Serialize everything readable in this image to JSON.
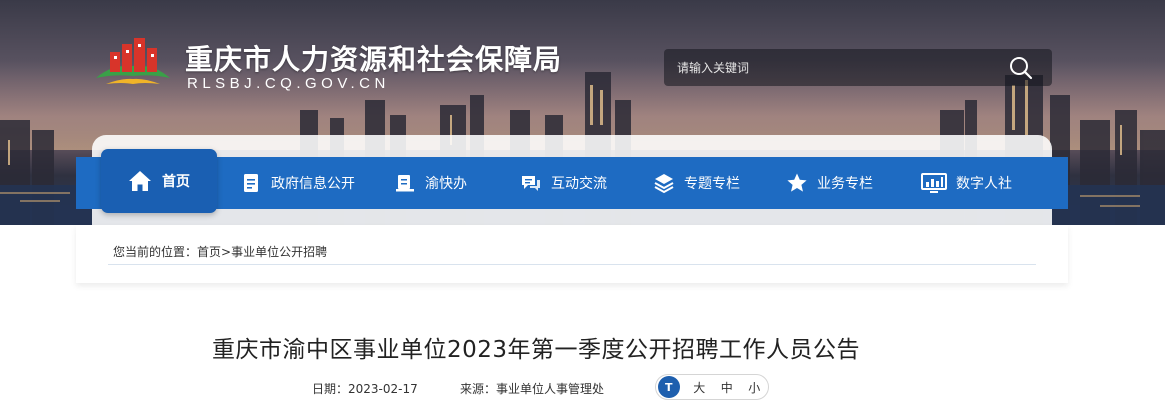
{
  "header": {
    "title": "重庆市人力资源和社会保障局",
    "domain": "RLSBJ.CQ.GOV.CN",
    "search": {
      "placeholder": "请输入关键词",
      "icon": "search-icon"
    }
  },
  "nav": {
    "items": [
      {
        "label": "首页",
        "icon": "home-icon",
        "active": true
      },
      {
        "label": "政府信息公开",
        "icon": "document-icon"
      },
      {
        "label": "渝快办",
        "icon": "desk-icon"
      },
      {
        "label": "互动交流",
        "icon": "chat-icon"
      },
      {
        "label": "专题专栏",
        "icon": "layers-icon"
      },
      {
        "label": "业务专栏",
        "icon": "star-icon"
      },
      {
        "label": "数字人社",
        "icon": "monitor-chart-icon"
      }
    ]
  },
  "breadcrumb": {
    "prefix": "您当前的位置：",
    "home": "首页",
    "separator": ">",
    "current": "事业单位公开招聘"
  },
  "article": {
    "title": "重庆市渝中区事业单位2023年第一季度公开招聘工作人员公告",
    "date_label": "日期：",
    "date": "2023-02-17",
    "source_label": "来源：",
    "source": "事业单位人事管理处",
    "font_size": {
      "icon_text": "T",
      "large": "大",
      "medium": "中",
      "small": "小"
    }
  },
  "colors": {
    "nav_blue": "#1e6bc2",
    "nav_active": "#1a5fb2",
    "logo_red": "#d8342a",
    "logo_green": "#3aa048"
  }
}
